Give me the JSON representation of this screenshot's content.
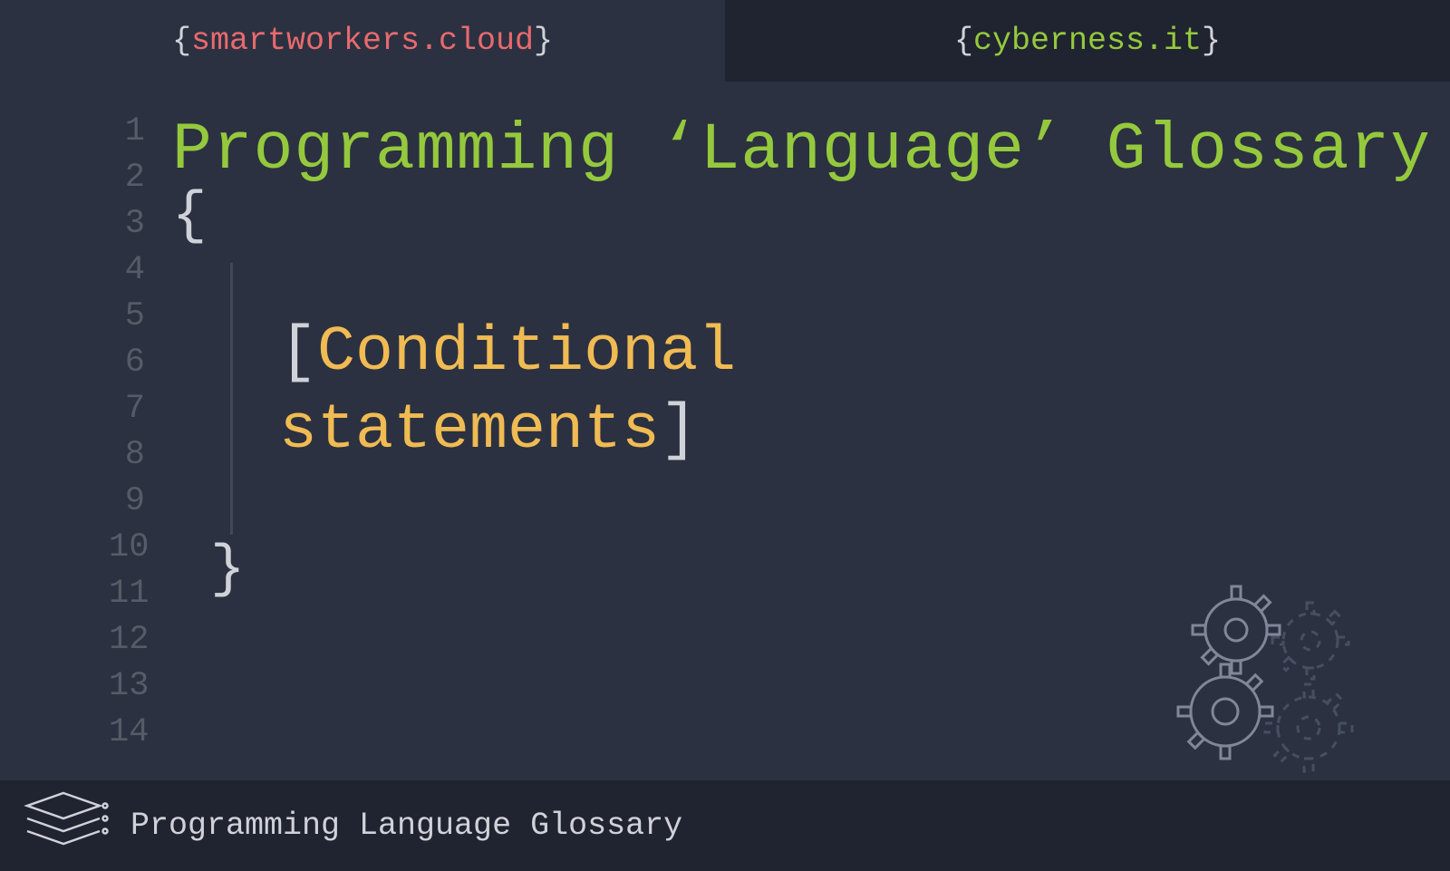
{
  "header": {
    "left": {
      "open": "{",
      "text": "smartworkers.cloud",
      "close": "}"
    },
    "right": {
      "open": "{",
      "text": "cyberness.it",
      "close": "}"
    }
  },
  "editor": {
    "line_numbers": [
      "1",
      "2",
      "3",
      "4",
      "5",
      "6",
      "7",
      "8",
      "9",
      "10",
      "11",
      "12",
      "13",
      "14"
    ],
    "title": "Programming ‘Language’ Glossary",
    "open_brace": "{",
    "close_brace": "}",
    "topic_open": "[",
    "topic_line1": "Conditional",
    "topic_line2": "statements",
    "topic_close": "]"
  },
  "footer": {
    "text": "Programming Language Glossary"
  }
}
